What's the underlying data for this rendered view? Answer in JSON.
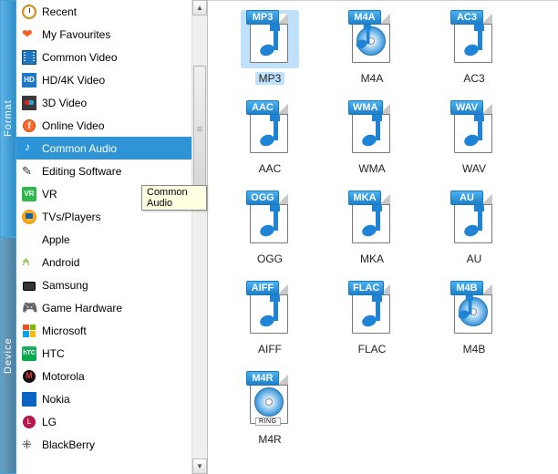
{
  "vertical_tabs": {
    "format": "Format",
    "device": "Device"
  },
  "sidebar": {
    "items": [
      {
        "label": "Recent",
        "icon": "clock-icon"
      },
      {
        "label": "My Favourites",
        "icon": "heart-icon"
      },
      {
        "label": "Common Video",
        "icon": "film-icon"
      },
      {
        "label": "HD/4K Video",
        "icon": "hd-icon"
      },
      {
        "label": "3D Video",
        "icon": "3d-glasses-icon"
      },
      {
        "label": "Online Video",
        "icon": "globe-icon"
      },
      {
        "label": "Common Audio",
        "icon": "music-note-icon",
        "selected": true
      },
      {
        "label": "Editing Software",
        "icon": "pencil-icon"
      },
      {
        "label": "VR",
        "icon": "vr-icon"
      },
      {
        "label": "TVs/Players",
        "icon": "tv-icon"
      },
      {
        "label": "Apple",
        "icon": "apple-icon"
      },
      {
        "label": "Android",
        "icon": "android-icon"
      },
      {
        "label": "Samsung",
        "icon": "samsung-icon"
      },
      {
        "label": "Game Hardware",
        "icon": "gamepad-icon"
      },
      {
        "label": "Microsoft",
        "icon": "microsoft-icon"
      },
      {
        "label": "HTC",
        "icon": "htc-icon"
      },
      {
        "label": "Motorola",
        "icon": "motorola-icon"
      },
      {
        "label": "Nokia",
        "icon": "nokia-icon"
      },
      {
        "label": "LG",
        "icon": "lg-icon"
      },
      {
        "label": "BlackBerry",
        "icon": "blackberry-icon"
      }
    ]
  },
  "tooltip": "Common Audio",
  "formats": [
    {
      "badge": "MP3",
      "label": "MP3",
      "art": "note",
      "selected": true
    },
    {
      "badge": "M4A",
      "label": "M4A",
      "art": "disc"
    },
    {
      "badge": "AC3",
      "label": "AC3",
      "art": "note"
    },
    {
      "badge": "AAC",
      "label": "AAC",
      "art": "note"
    },
    {
      "badge": "WMA",
      "label": "WMA",
      "art": "note"
    },
    {
      "badge": "WAV",
      "label": "WAV",
      "art": "note"
    },
    {
      "badge": "OGG",
      "label": "OGG",
      "art": "note"
    },
    {
      "badge": "MKA",
      "label": "MKA",
      "art": "note"
    },
    {
      "badge": "AU",
      "label": "AU",
      "art": "note"
    },
    {
      "badge": "AIFF",
      "label": "AIFF",
      "art": "note"
    },
    {
      "badge": "FLAC",
      "label": "FLAC",
      "art": "note"
    },
    {
      "badge": "M4B",
      "label": "M4B",
      "art": "disc"
    },
    {
      "badge": "M4R",
      "label": "M4R",
      "art": "ring"
    }
  ],
  "ring_badge_text": "RING"
}
